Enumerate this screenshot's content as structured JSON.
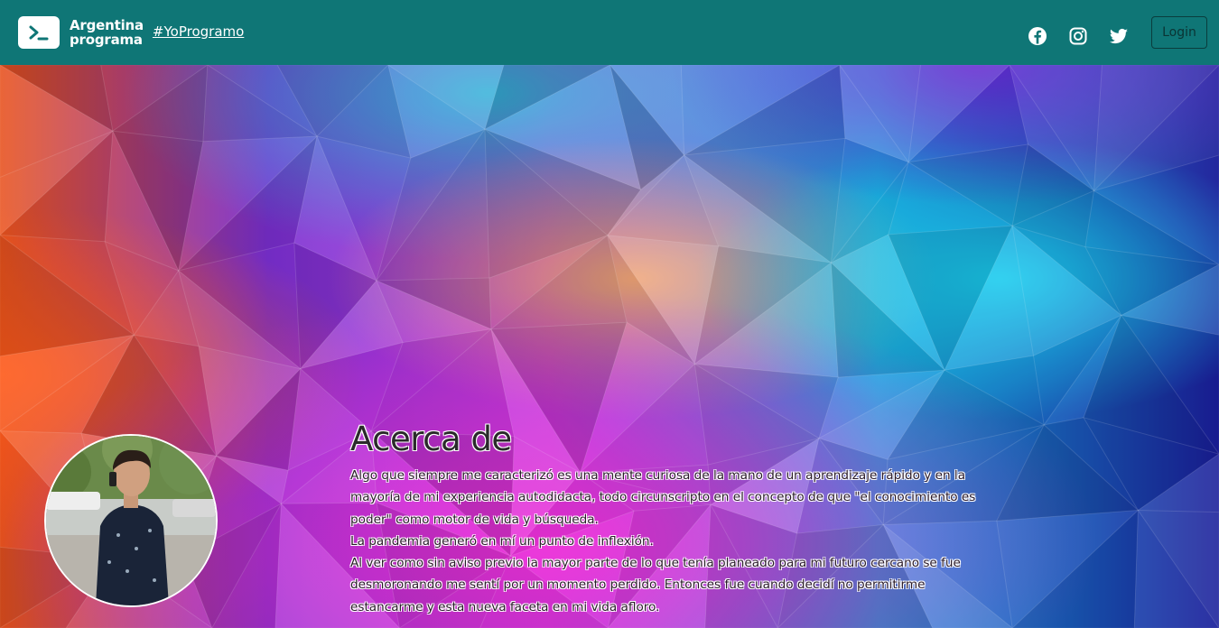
{
  "navbar": {
    "brand_line1": "Argentina",
    "brand_line2": "programa",
    "hashtag": "#YoProgramo",
    "login_label": "Login",
    "background_color": "#0f7676",
    "social_icons": [
      "facebook-icon",
      "instagram-icon",
      "twitter-icon"
    ]
  },
  "about": {
    "title": "Acerca de",
    "paragraph": "Algo que siempre me caracterizó es una mente curiosa de la mano de un aprendizaje rápido y en la mayoría de mi experiencia autodidacta, todo circunscripto en el concepto de que \"el conocimiento es poder\" como motor de vida y búsqueda.\nLa pandemia generó en mí un punto de inflexión.\nAl ver como sin aviso previo la mayor parte de lo que tenía planeado para mi futuro cercano se fue desmoronando me sentí por un momento perdido. Entonces fue cuando decidí no permitirme estancarme y esta nueva faceta en mi vida afloro."
  },
  "hero": {
    "background_style": "low-poly gradient",
    "colors": [
      "#e04a1e",
      "#7a2bd0",
      "#1ab8d8",
      "#e020c8",
      "#1a2a9e"
    ]
  }
}
